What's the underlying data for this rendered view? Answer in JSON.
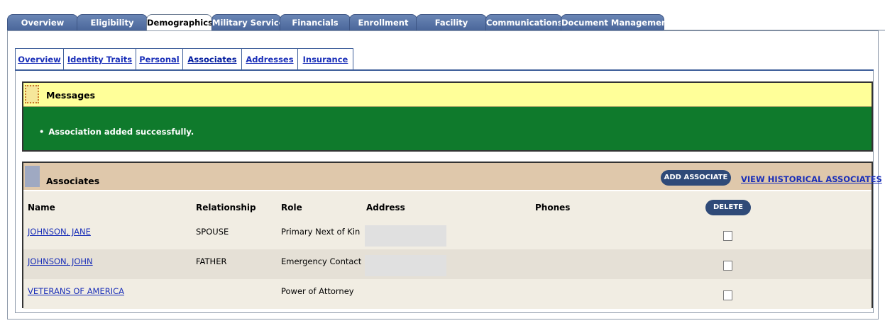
{
  "top_tabs": [
    {
      "label": "Overview"
    },
    {
      "label": "Eligibility"
    },
    {
      "label": "Demographics"
    },
    {
      "label": "Military Service"
    },
    {
      "label": "Financials"
    },
    {
      "label": "Enrollment"
    },
    {
      "label": "Facility"
    },
    {
      "label": "Communications"
    },
    {
      "label": "Document Management"
    }
  ],
  "active_top_tab": "Demographics",
  "sub_tabs": [
    {
      "label": "Overview"
    },
    {
      "label": "Identity Traits"
    },
    {
      "label": "Personal"
    },
    {
      "label": "Associates"
    },
    {
      "label": "Addresses"
    },
    {
      "label": "Insurance"
    }
  ],
  "active_sub_tab": "Associates",
  "messages": {
    "title": "Messages",
    "items": [
      "Association added successfully."
    ]
  },
  "associates": {
    "title": "Associates",
    "add_button": "ADD ASSOCIATE",
    "history_link": "VIEW HISTORICAL ASSOCIATES",
    "delete_button": "DELETE",
    "columns": {
      "name": "Name",
      "relationship": "Relationship",
      "role": "Role",
      "address": "Address",
      "phones": "Phones"
    },
    "rows": [
      {
        "name": "JOHNSON, JANE",
        "relationship": "SPOUSE",
        "role": "Primary Next of Kin",
        "address": "",
        "phones": ""
      },
      {
        "name": "JOHNSON, JOHN",
        "relationship": "FATHER",
        "role": "Emergency Contact",
        "address": "",
        "phones": ""
      },
      {
        "name": "VETERANS OF AMERICA",
        "relationship": "",
        "role": "Power of Attorney",
        "address": "",
        "phones": ""
      }
    ]
  },
  "colors": {
    "tab_blue": "#4a669a",
    "message_header": "#ffff99",
    "message_success": "#0f7a2c",
    "associates_header": "#dfc8ab",
    "button_navy": "#2f4a78",
    "link_blue": "#1a2fb8"
  }
}
